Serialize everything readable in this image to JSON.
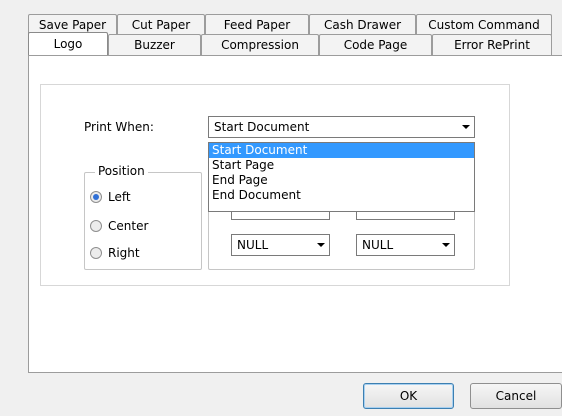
{
  "tabs": {
    "back_row": [
      "Save Paper",
      "Cut Paper",
      "Feed Paper",
      "Cash Drawer",
      "Custom Command"
    ],
    "front_row": [
      "Logo",
      "Buzzer",
      "Compression",
      "Code Page",
      "Error RePrint"
    ],
    "active": "Logo"
  },
  "logo": {
    "print_when_label": "Print When:",
    "print_when_value": "Start Document",
    "print_when_options": [
      "Start Document",
      "Start Page",
      "End Page",
      "End Document"
    ],
    "position": {
      "title": "Position",
      "options": [
        "Left",
        "Center",
        "Right"
      ],
      "selected": "Left"
    },
    "combo_left_value": "NULL",
    "combo_right_value": "NULL"
  },
  "buttons": {
    "ok": "OK",
    "cancel": "Cancel"
  },
  "colors": {
    "selection": "#3399ff",
    "radio_on": "#2f6fd6"
  }
}
